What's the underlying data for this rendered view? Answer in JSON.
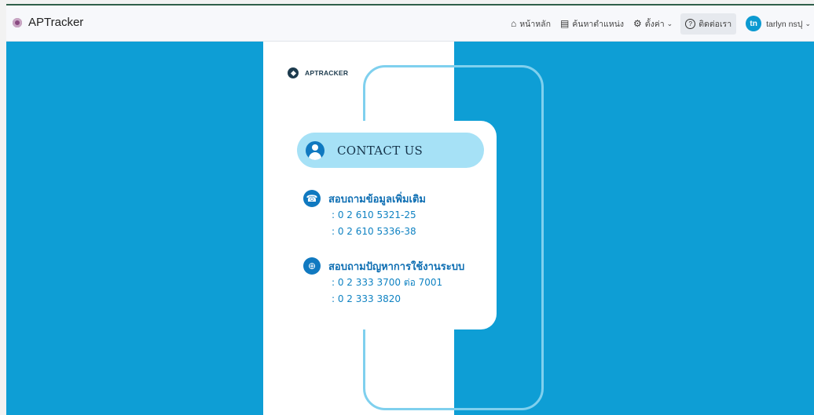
{
  "app": {
    "title": "APTracker"
  },
  "nav": {
    "items": [
      {
        "label": "หน้าหลัก",
        "icon": "home-icon",
        "glyph": "⌂"
      },
      {
        "label": "ค้นหาตำแหน่ง",
        "icon": "list-icon",
        "glyph": "▤"
      },
      {
        "label": "ตั้งค่า",
        "icon": "gear-icon",
        "glyph": "⚙"
      }
    ],
    "contact": {
      "label": "ติดต่อเรา",
      "icon": "help-icon",
      "glyph": "?"
    },
    "user": {
      "initials": "tn",
      "name": "tarlyn nsปุ"
    }
  },
  "content": {
    "logo_text": "APTRACKER",
    "contact_heading": "CONTACT US",
    "sections": [
      {
        "title": "สอบถามข้อมูลเพิ่มเติม",
        "icon": "phone-icon",
        "glyph": "☎",
        "phones": [
          ": 0 2 610 5321-25",
          ": 0 2 610 5336-38"
        ]
      },
      {
        "title": "สอบถามปัญหาการใช้งานระบบ",
        "icon": "globe-icon",
        "glyph": "⊕",
        "phones": [
          ": 0 2 333 3700 ต่อ 7001",
          ": 0 2 333 3820"
        ]
      }
    ]
  },
  "colors": {
    "background": "#0e9ed5",
    "accent": "#1079c0",
    "pill": "#a6e1f6",
    "frame": "#7fd0ee",
    "text_blue": "#0f82c2"
  }
}
